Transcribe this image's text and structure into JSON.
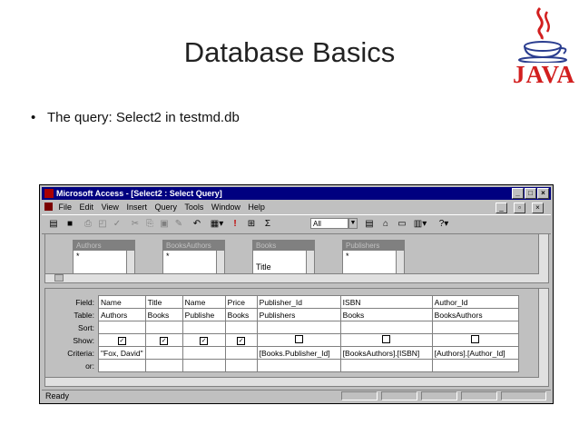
{
  "slide": {
    "title": "Database Basics",
    "bullet": "The query: Select2 in testmd.db",
    "logo_text": "JAVA"
  },
  "window": {
    "title": "Microsoft Access - [Select2 : Select Query]",
    "menu": [
      "File",
      "Edit",
      "View",
      "Insert",
      "Query",
      "Tools",
      "Window",
      "Help"
    ],
    "toolbar": {
      "combo_value": "All",
      "sigma": "Σ",
      "bang": "!",
      "undo": "↶"
    },
    "tables": [
      {
        "name": "Authors",
        "field": "*"
      },
      {
        "name": "BooksAuthors",
        "field": "*"
      },
      {
        "name": "Books",
        "field": "Title"
      },
      {
        "name": "Publishers",
        "field": "*"
      }
    ],
    "grid": {
      "row_labels": {
        "field": "Field:",
        "table": "Table:",
        "sort": "Sort:",
        "show": "Show:",
        "criteria": "Criteria:",
        "or": "or:"
      },
      "columns": [
        {
          "field": "Name",
          "table": "Authors",
          "show": true,
          "criteria": "\"Fox, David\""
        },
        {
          "field": "Title",
          "table": "Books",
          "show": true,
          "criteria": ""
        },
        {
          "field": "Name",
          "table": "Publishe",
          "show": true,
          "criteria": ""
        },
        {
          "field": "Price",
          "table": "Books",
          "show": true,
          "criteria": ""
        },
        {
          "field": "Publisher_Id",
          "table": "Publishers",
          "show": false,
          "criteria": "[Books.Publisher_Id]"
        },
        {
          "field": "ISBN",
          "table": "Books",
          "show": false,
          "criteria": "[BooksAuthors].[ISBN]"
        },
        {
          "field": "Author_Id",
          "table": "BooksAuthors",
          "show": false,
          "criteria": "[Authors].[Author_Id]"
        }
      ]
    },
    "status": "Ready"
  }
}
